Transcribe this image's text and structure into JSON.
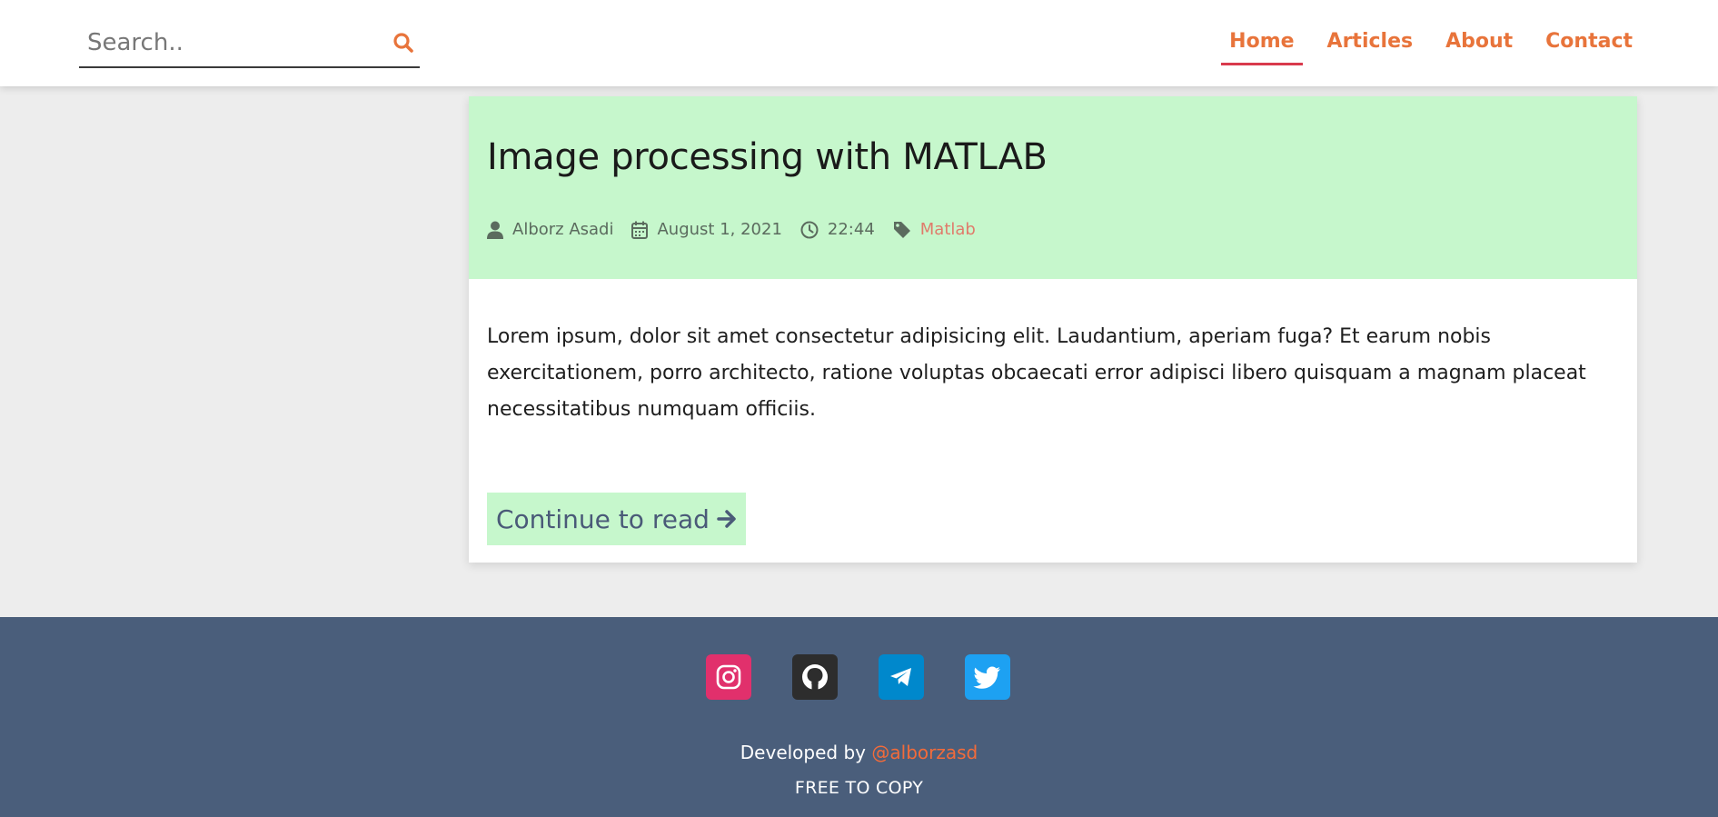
{
  "search": {
    "placeholder": "Search..",
    "icon": "search-icon"
  },
  "nav": {
    "items": [
      {
        "label": "Home",
        "active": true
      },
      {
        "label": "Articles",
        "active": false
      },
      {
        "label": "About",
        "active": false
      },
      {
        "label": "Contact",
        "active": false
      }
    ]
  },
  "article": {
    "title": "Image processing with MATLAB",
    "author": "Alborz Asadi",
    "date": "August 1, 2021",
    "time": "22:44",
    "tag": "Matlab",
    "excerpt": "Lorem ipsum, dolor sit amet consectetur adipisicing elit. Laudantium, aperiam fuga? Et earum nobis exercitationem, porro architecto, ratione voluptas obcaecati error adipisci libero quisquam a magnam placeat necessitatibus numquam officiis.",
    "read_more": "Continue to read"
  },
  "footer": {
    "socials": [
      "instagram-icon",
      "github-icon",
      "telegram-icon",
      "twitter-icon"
    ],
    "developed_prefix": "Developed by",
    "developer_handle": "@alborzasd",
    "copy_note": "FREE TO COPY"
  },
  "colors": {
    "accent": "#e8743b",
    "active_underline": "#d93a4d",
    "card_header": "#c6f7cc",
    "footer_bg": "#4a5e7b",
    "page_bg": "#ededed"
  }
}
